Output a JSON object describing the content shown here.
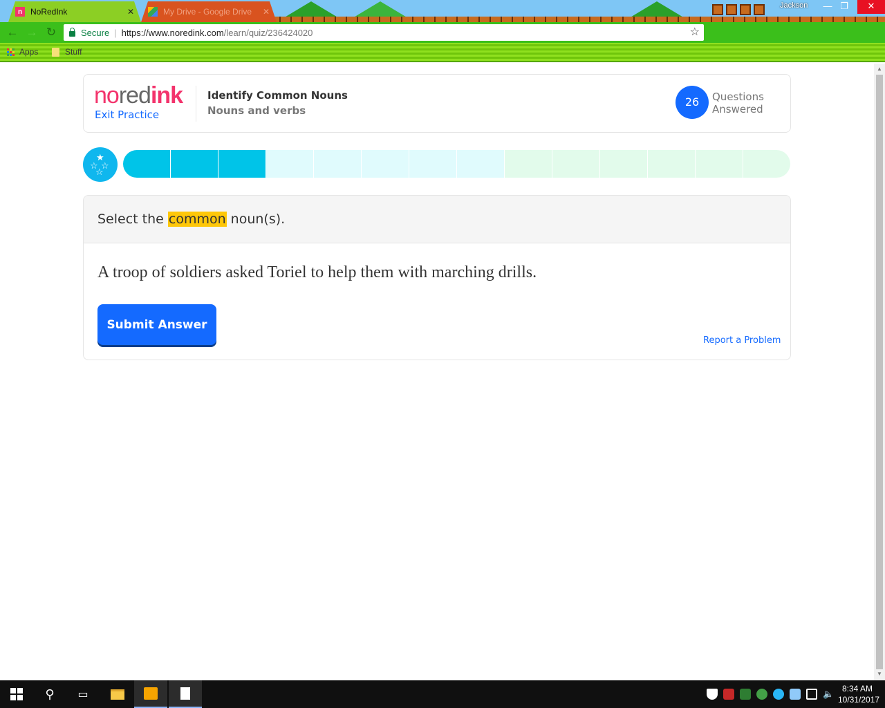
{
  "browser": {
    "tabs": [
      {
        "title": "NoRedInk",
        "active": true
      },
      {
        "title": "My Drive - Google Drive",
        "active": false
      }
    ],
    "user": "Jackson",
    "window_controls": {
      "minimize": "—",
      "restore": "❐",
      "close": "✕"
    },
    "address": {
      "secure_label": "Secure",
      "url_host": "https://www.noredink.com",
      "url_path": "/learn/quiz/236424020"
    },
    "bookmarks": [
      {
        "label": "Apps",
        "icon": "apps-grid-icon"
      },
      {
        "label": "Stuff",
        "icon": "folder-icon"
      }
    ]
  },
  "header": {
    "logo": {
      "no": "no",
      "red": "red",
      "ink": "ink"
    },
    "exit_label": "Exit Practice",
    "quiz_title": "Identify Common Nouns",
    "quiz_subtitle": "Nouns and verbs",
    "questions_answered": "26",
    "questions_label_line1": "Questions",
    "questions_label_line2": "Answered"
  },
  "progress": {
    "total_segments": 14,
    "completed_segments": 3,
    "colors": {
      "completed": "#00c4e8",
      "remaining_early": "#e0fbfd",
      "remaining_late": "#e2fbeb"
    }
  },
  "question": {
    "prompt_before": "Select the ",
    "prompt_highlight": "common",
    "prompt_after": " noun(s).",
    "sentence": "A troop of soldiers asked Toriel to help them with marching drills.",
    "submit_label": "Submit Answer",
    "report_label": "Report a Problem"
  },
  "colors": {
    "brand_pink": "#f3336c",
    "primary_blue": "#146aff",
    "highlight_yellow": "#fec709",
    "star_badge": "#0fb7ee"
  },
  "taskbar": {
    "time": "8:34 AM",
    "date": "10/31/2017"
  }
}
